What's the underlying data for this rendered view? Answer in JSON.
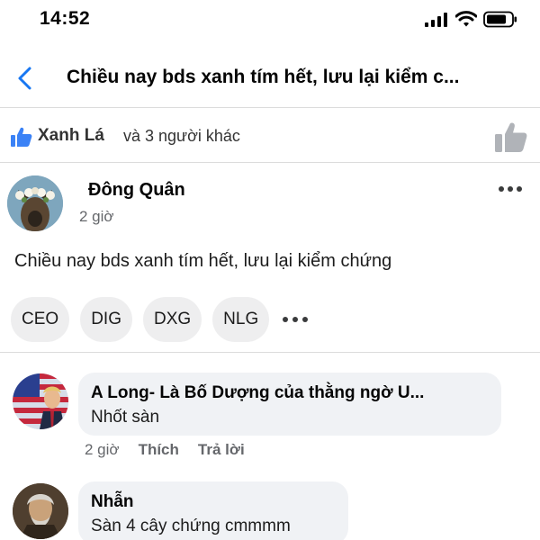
{
  "status_bar": {
    "time": "14:52"
  },
  "header": {
    "title": "Chiều nay bds xanh tím hết, lưu lại kiểm c..."
  },
  "reactions": {
    "name": "Xanh Lá",
    "others": "và 3 người khác"
  },
  "post": {
    "author": "Đông Quân",
    "time": "2 giờ",
    "text": "Chiều nay bds xanh tím hết, lưu lại kiểm chứng",
    "tags": [
      "CEO",
      "DIG",
      "DXG",
      "NLG"
    ]
  },
  "comments": [
    {
      "author": "A Long- Là Bố Dượng của thằng ngờ U...",
      "text": "Nhốt sàn",
      "time": "2 giờ",
      "like_label": "Thích",
      "reply_label": "Trả lời"
    },
    {
      "author": "Nhẫn",
      "text": "Sàn 4 cây chứng cmmmm"
    }
  ],
  "colors": {
    "accent": "#1877f2",
    "muted": "#65676b",
    "bubble": "#f0f2f5"
  },
  "icons": [
    "signal-icon",
    "wifi-icon",
    "battery-icon",
    "back-icon",
    "like-badge-icon",
    "like-button-icon",
    "more-icon"
  ]
}
